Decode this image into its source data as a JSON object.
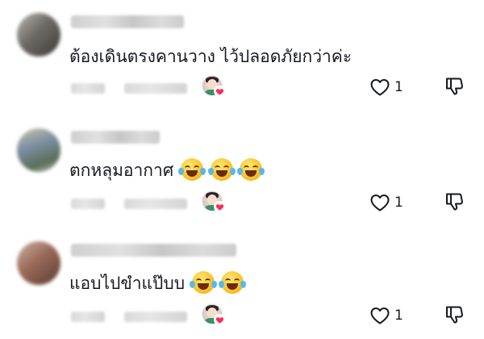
{
  "comments": [
    {
      "username": "",
      "text": "ต้องเดินตรงคานวาง ไว้ปลอดภัยกว่าค่ะ",
      "emojis": [],
      "time": "",
      "reply_label": "",
      "like_count": "1",
      "creator_liked": true
    },
    {
      "username": "",
      "text": "ตกหลุมอากาศ",
      "emojis": [
        "face-with-tears-of-joy",
        "face-with-tears-of-joy",
        "face-with-tears-of-joy"
      ],
      "time": "",
      "reply_label": "",
      "like_count": "1",
      "creator_liked": true
    },
    {
      "username": "",
      "text": "แอบไปขำแป๊บบ",
      "emojis": [
        "face-with-tears-of-joy",
        "face-with-tears-of-joy"
      ],
      "time": "",
      "reply_label": "",
      "like_count": "1",
      "creator_liked": true
    }
  ],
  "colors": {
    "text": "#161823",
    "heart": "#fe2c55",
    "icon": "#161823"
  }
}
